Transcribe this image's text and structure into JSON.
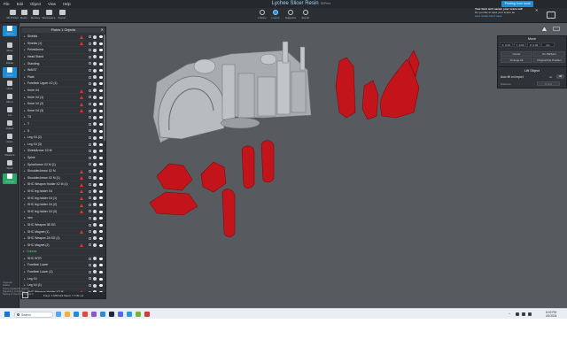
{
  "app": {
    "title": "Lychee Slicer Resin",
    "subtitle": "3DPrint",
    "menus": [
      "File",
      "Edit",
      "Object",
      "View",
      "Help"
    ]
  },
  "toolbar": {
    "left_buttons": [
      "3D Printer",
      "Resin",
      "Monkey",
      "Workspace",
      "Export"
    ],
    "tabs": [
      "Library",
      "Layout",
      "Supports",
      "Export"
    ],
    "active_tab": "Layout",
    "print_button": "Printing from local"
  },
  "notice": {
    "line1": "Your form isn't saved, your scene will",
    "line2": "Do you like to save your scene as",
    "link1": "save locally",
    "link2": "Don't save",
    "close": "✕"
  },
  "left_tools": [
    "Select",
    "Move",
    "Rotate",
    "Scale",
    "Undo",
    "Mirror",
    "Cut",
    "Hollow",
    "Drain",
    "Measure",
    "Stack",
    "Arrange"
  ],
  "object_panel": {
    "header": "Plates 1 Objects",
    "close": "✕",
    "footer": "Polys: 17887122 Mesh: 7.77M vol",
    "rows": [
      {
        "name": "Shields",
        "warn": true,
        "group": false
      },
      {
        "name": "Shields (1)",
        "warn": true,
        "group": false
      },
      {
        "name": "PelvisArmor",
        "warn": false,
        "group": false
      },
      {
        "name": "Head Stand",
        "warn": false,
        "group": false
      },
      {
        "name": "Standing",
        "warn": false,
        "group": false
      },
      {
        "name": "WAIST",
        "warn": false,
        "group": false
      },
      {
        "name": "Plate",
        "warn": false,
        "group": false
      },
      {
        "name": "Forelimb Upper X2 (1)",
        "warn": false,
        "group": false
      },
      {
        "name": "Knee X4",
        "warn": true,
        "group": false
      },
      {
        "name": "Knee X4 (1)",
        "warn": true,
        "group": false
      },
      {
        "name": "Knee X4 (2)",
        "warn": true,
        "group": false
      },
      {
        "name": "Knee X4 (3)",
        "warn": true,
        "group": false
      },
      {
        "name": "T3",
        "warn": false,
        "group": false
      },
      {
        "name": "T",
        "warn": false,
        "group": false
      },
      {
        "name": "S",
        "warn": false,
        "group": false
      },
      {
        "name": "Leg X4 (2)",
        "warn": false,
        "group": false
      },
      {
        "name": "Leg X4 (3)",
        "warn": false,
        "group": false
      },
      {
        "name": "ShieldArmor X2 M",
        "warn": false,
        "group": false
      },
      {
        "name": "Spine",
        "warn": false,
        "group": false
      },
      {
        "name": "SpineArmor X2 M (1)",
        "warn": false,
        "group": false
      },
      {
        "name": "ShoulderArmor X2 M",
        "warn": true,
        "group": false
      },
      {
        "name": "ShoulderArmor X2 M (1)",
        "warn": true,
        "group": false
      },
      {
        "name": "SHC Weapon Holder X2 M (1)",
        "warn": true,
        "group": false
      },
      {
        "name": "SHC leg holder X4",
        "warn": true,
        "group": false
      },
      {
        "name": "SHC leg holder X4 (1)",
        "warn": true,
        "group": false
      },
      {
        "name": "SHC leg holder X4 (2)",
        "warn": true,
        "group": false
      },
      {
        "name": "SHC leg holder X4 (3)",
        "warn": true,
        "group": false
      },
      {
        "name": "neo",
        "warn": false,
        "group": false
      },
      {
        "name": "SHC Weapon 3B SG",
        "warn": false,
        "group": false
      },
      {
        "name": "SHC Magnet (1)",
        "warn": true,
        "group": false
      },
      {
        "name": "SHC Weapon 2A SG (1)",
        "warn": false,
        "group": false
      },
      {
        "name": "SHC Magnet (2)",
        "warn": true,
        "group": false
      },
      {
        "name": "Outside",
        "warn": false,
        "group": true
      },
      {
        "name": "SHC WTR",
        "warn": false,
        "group": false
      },
      {
        "name": "Forelimb Lower",
        "warn": false,
        "group": false
      },
      {
        "name": "Forelimb Lower (1)",
        "warn": false,
        "group": false
      },
      {
        "name": "Leg X4",
        "warn": false,
        "group": false
      },
      {
        "name": "Leg X4 (1)",
        "warn": false,
        "group": false
      },
      {
        "name": "SHC Weapon Holder X2 M",
        "warn": true,
        "group": false
      }
    ]
  },
  "move_panel": {
    "title": "Move",
    "axes": [
      "X: 0.00",
      "Y: 0.00",
      "Z: 0.00",
      "mm"
    ],
    "center_label": "Center",
    "on_platform_label": "On Platform",
    "arrange_label": "Arrange All",
    "original_label": "Original File Position"
  },
  "lift_panel": {
    "title": "Lift Object",
    "auto_lift_label": "Auto lift on import",
    "on": "on",
    "off": "off",
    "distance_label": "Distance",
    "distance_value": "5 mm"
  },
  "bottom_log": [
    "Inspector",
    "Hollow",
    "Scene loaded 39 objects",
    "Repairing: 0 objects",
    "Saving to cloud: not signed in"
  ],
  "taskbar": {
    "search_placeholder": "Search",
    "time": "8:00 PM",
    "date": "4/1/2024"
  },
  "colors": {
    "background": "#575a5e",
    "panel": "#2f3236",
    "accent": "#1c8ed8",
    "model_grey": "#aeb1b4",
    "model_red": "#c4141b",
    "warning": "#e6332a",
    "group_green": "#47d07a"
  }
}
